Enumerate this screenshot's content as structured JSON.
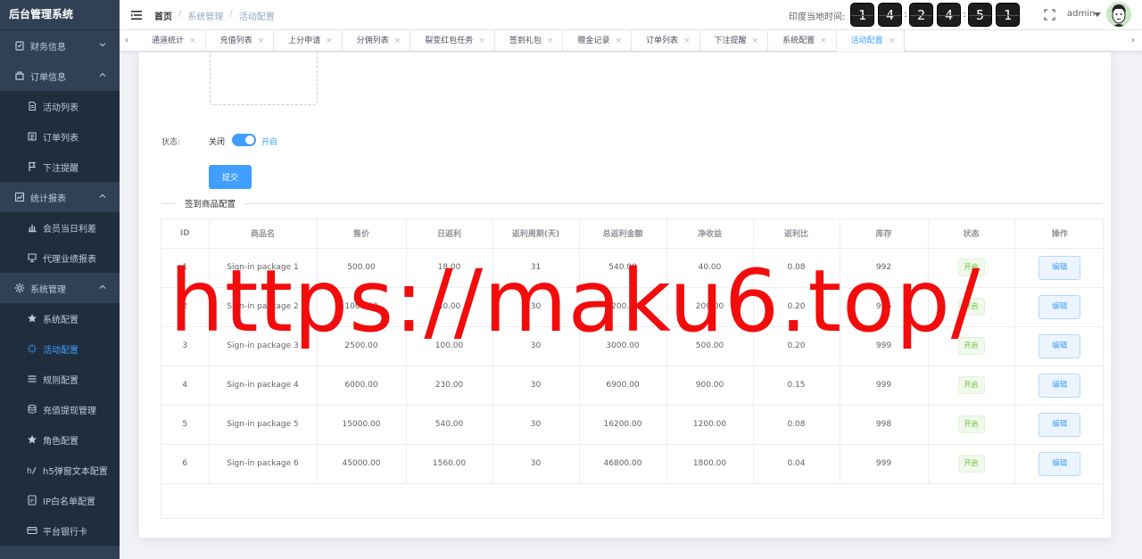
{
  "app": {
    "title": "后台管理系统"
  },
  "sidebar": {
    "items": [
      {
        "label": "财务信息",
        "type": "group",
        "icon": "finance-icon",
        "arrow": "down"
      },
      {
        "label": "订单信息",
        "type": "group",
        "icon": "order-icon",
        "arrow": "up"
      },
      {
        "label": "活动列表",
        "type": "sub",
        "icon": "document-icon"
      },
      {
        "label": "订单列表",
        "type": "sub",
        "icon": "list-icon"
      },
      {
        "label": "下注提醒",
        "type": "sub",
        "icon": "flag-icon"
      },
      {
        "label": "统计报表",
        "type": "group",
        "icon": "chart-icon",
        "arrow": "up"
      },
      {
        "label": "会员当日利差",
        "type": "sub",
        "icon": "bar-chart-icon"
      },
      {
        "label": "代理业绩报表",
        "type": "sub",
        "icon": "report-icon"
      },
      {
        "label": "系统管理",
        "type": "group",
        "icon": "gear-icon",
        "arrow": "up"
      },
      {
        "label": "系统配置",
        "type": "sub",
        "icon": "star-icon"
      },
      {
        "label": "活动配置",
        "type": "sub",
        "icon": "sparkle-icon",
        "active": true
      },
      {
        "label": "规则配置",
        "type": "sub",
        "icon": "lines-icon"
      },
      {
        "label": "充值提现管理",
        "type": "sub",
        "icon": "database-icon"
      },
      {
        "label": "角色配置",
        "type": "sub",
        "icon": "star-icon"
      },
      {
        "label": "h5弹窗文本配置",
        "type": "sub",
        "icon": "text-icon"
      },
      {
        "label": "IP白名单配置",
        "type": "sub",
        "icon": "ip-icon"
      },
      {
        "label": "平台银行卡",
        "type": "sub",
        "icon": "card-icon"
      }
    ]
  },
  "header": {
    "breadcrumb": [
      "首页",
      "系统管理",
      "活动配置"
    ],
    "time_label": "印度当地时间:",
    "clock_digits": [
      "1",
      "4",
      "2",
      "4",
      "5",
      "1"
    ],
    "user_name": "admin"
  },
  "tabs": [
    {
      "label": "通道统计"
    },
    {
      "label": "充值列表"
    },
    {
      "label": "上分申请"
    },
    {
      "label": "分佣列表"
    },
    {
      "label": "裂变红包任务"
    },
    {
      "label": "签到礼包"
    },
    {
      "label": "赠金记录"
    },
    {
      "label": "订单列表"
    },
    {
      "label": "下注提醒"
    },
    {
      "label": "系统配置"
    },
    {
      "label": "活动配置",
      "active": true
    }
  ],
  "form": {
    "status_label": "状态:",
    "switch_off_label": "关闭",
    "switch_on_label": "开启",
    "submit_label": "提交",
    "section_title": "签到商品配置"
  },
  "table": {
    "columns": [
      "ID",
      "商品名",
      "售价",
      "日返利",
      "返利周期(天)",
      "总返利金额",
      "净收益",
      "返利比",
      "库存",
      "状态",
      "操作"
    ],
    "rows": [
      [
        "1",
        "Sign-in package 1",
        "500.00",
        "18.00",
        "31",
        "540.00",
        "40.00",
        "0.08",
        "992",
        "开启",
        "编辑"
      ],
      [
        "2",
        "Sign-in package 2",
        "1000.00",
        "40.00",
        "30",
        "1200.00",
        "200.00",
        "0.20",
        "996",
        "开启",
        "编辑"
      ],
      [
        "3",
        "Sign-in package 3",
        "2500.00",
        "100.00",
        "30",
        "3000.00",
        "500.00",
        "0.20",
        "999",
        "开启",
        "编辑"
      ],
      [
        "4",
        "Sign-in package 4",
        "6000.00",
        "230.00",
        "30",
        "6900.00",
        "900.00",
        "0.15",
        "999",
        "开启",
        "编辑"
      ],
      [
        "5",
        "Sign-in package 5",
        "15000.00",
        "540.00",
        "30",
        "16200.00",
        "1200.00",
        "0.08",
        "998",
        "开启",
        "编辑"
      ],
      [
        "6",
        "Sign-in package 6",
        "45000.00",
        "1560.00",
        "30",
        "46800.00",
        "1800.00",
        "0.04",
        "999",
        "开启",
        "编辑"
      ]
    ]
  },
  "watermark": "https://maku6.top/",
  "colors": {
    "sidebar_bg": "#304156",
    "primary": "#409eff",
    "success": "#67c23a",
    "watermark": "#f20c0c"
  }
}
